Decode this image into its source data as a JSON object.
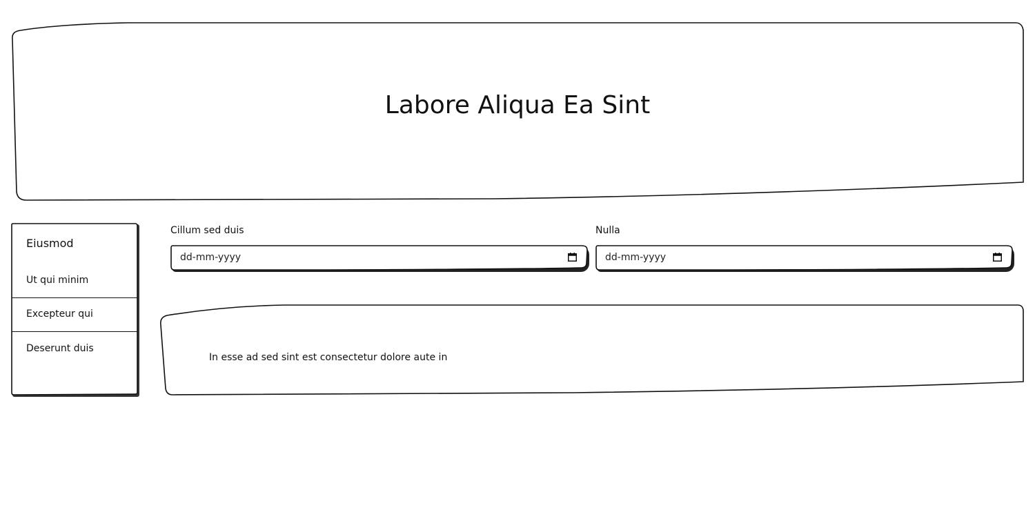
{
  "header": {
    "title": "Labore Aliqua Ea Sint"
  },
  "sidebar": {
    "heading": "Eiusmod",
    "items": [
      {
        "label": "Ut qui minim"
      },
      {
        "label": "Excepteur qui"
      },
      {
        "label": "Deserunt duis"
      }
    ]
  },
  "form": {
    "field1": {
      "label": "Cillum sed duis",
      "placeholder": "dd-mm-yyyy",
      "icon": "calendar-icon"
    },
    "field2": {
      "label": "Nulla",
      "placeholder": "dd-mm-yyyy",
      "icon": "calendar-icon"
    }
  },
  "content": {
    "text": "In esse ad sed sint est consectetur dolore aute in"
  }
}
